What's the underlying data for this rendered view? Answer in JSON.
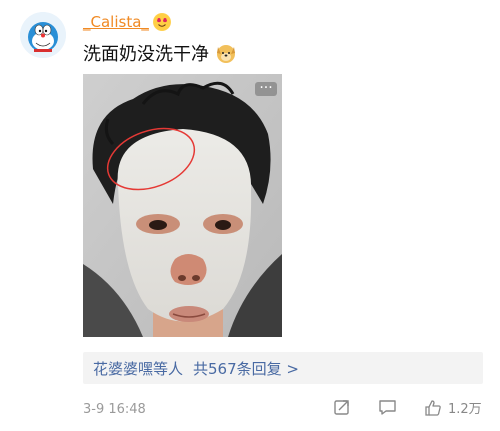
{
  "post": {
    "username": "_Calista_",
    "text": "洗面奶没洗干净",
    "timestamp": "3-9 16:48"
  },
  "replies": {
    "label": "花婆婆嘿等人",
    "count_text": "共567条回复 >"
  },
  "actions": {
    "like_count": "1.2万"
  },
  "icons": {
    "avatar": "doraemon-avatar",
    "username_badge": "heart-eyes-emoji",
    "post_emoji": "dog-face-emoji",
    "more": "more-dots-icon",
    "share": "share-icon",
    "comment": "comment-icon",
    "like": "thumbs-up-icon"
  },
  "colors": {
    "username": "#f08a24",
    "link": "#496aa3",
    "meta_text": "#9a9a9a",
    "reply_bg": "#f3f3f3"
  }
}
